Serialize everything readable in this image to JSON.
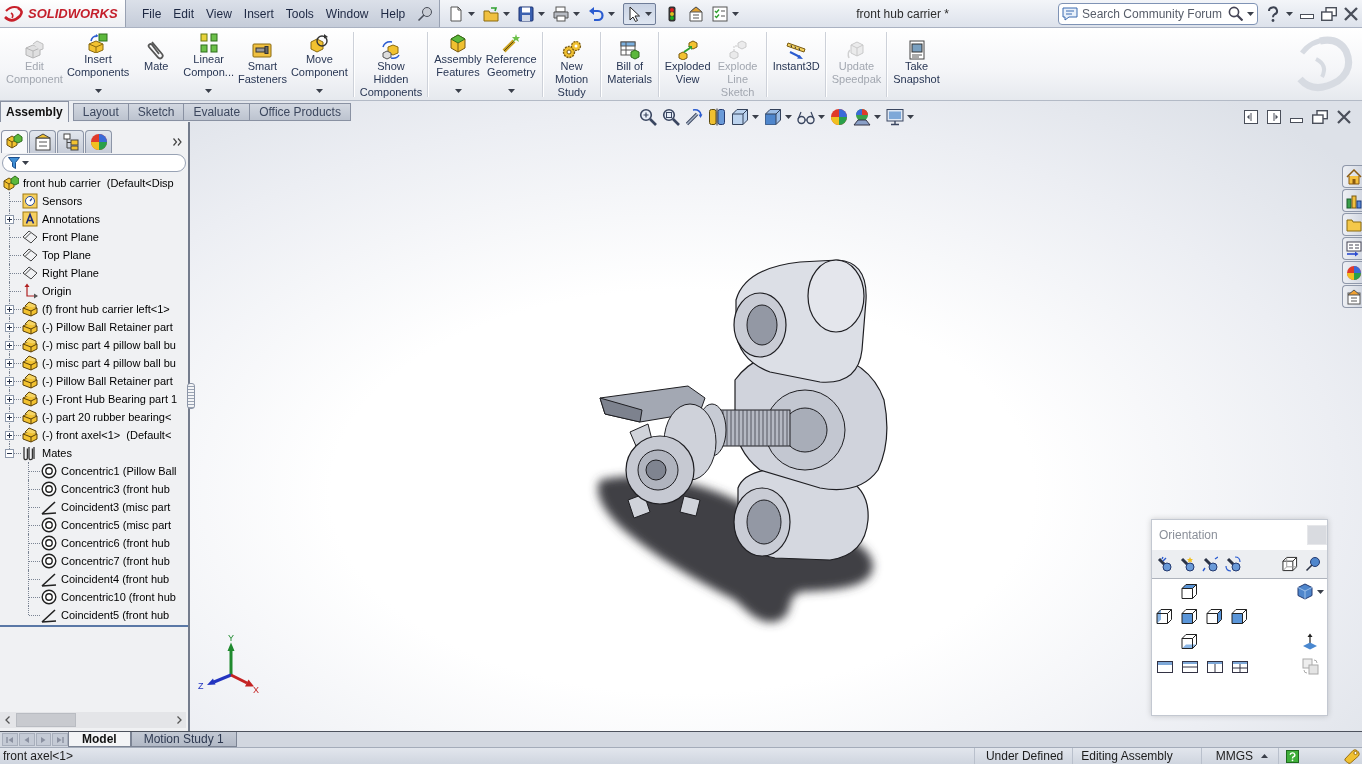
{
  "app": {
    "brand": "SOLIDWORKS",
    "menu": [
      "File",
      "Edit",
      "View",
      "Insert",
      "Tools",
      "Window",
      "Help"
    ],
    "title": "front hub carrier *",
    "search": {
      "placeholder": "Search Community Forum"
    }
  },
  "ribbon": {
    "groups": [
      [
        {
          "label": "Edit\nComponent",
          "disabled": true,
          "has_menu": false
        },
        {
          "label": "Insert\nComponents",
          "disabled": false,
          "has_menu": true
        },
        {
          "label": "Mate",
          "disabled": false,
          "has_menu": false
        },
        {
          "label": "Linear\nCompon...",
          "disabled": false,
          "has_menu": true
        },
        {
          "label": "Smart\nFasteners",
          "disabled": false,
          "has_menu": false
        },
        {
          "label": "Move\nComponent",
          "disabled": false,
          "has_menu": true
        }
      ],
      [
        {
          "label": "Show\nHidden\nComponents",
          "disabled": false,
          "has_menu": false
        }
      ],
      [
        {
          "label": "Assembly\nFeatures",
          "disabled": false,
          "has_menu": true
        },
        {
          "label": "Reference\nGeometry",
          "disabled": false,
          "has_menu": true
        }
      ],
      [
        {
          "label": "New\nMotion\nStudy",
          "disabled": false,
          "has_menu": false
        }
      ],
      [
        {
          "label": "Bill of\nMaterials",
          "disabled": false,
          "has_menu": false
        }
      ],
      [
        {
          "label": "Exploded\nView",
          "disabled": false,
          "has_menu": false
        },
        {
          "label": "Explode\nLine\nSketch",
          "disabled": true,
          "has_menu": false
        }
      ],
      [
        {
          "label": "Instant3D",
          "disabled": false,
          "has_menu": false
        }
      ],
      [
        {
          "label": "Update\nSpeedpak",
          "disabled": true,
          "has_menu": false
        }
      ],
      [
        {
          "label": "Take\nSnapshot",
          "disabled": false,
          "has_menu": false
        }
      ]
    ]
  },
  "command_tabs": [
    {
      "label": "Assembly",
      "selected": true
    },
    {
      "label": "Layout",
      "selected": false
    },
    {
      "label": "Sketch",
      "selected": false
    },
    {
      "label": "Evaluate",
      "selected": false
    },
    {
      "label": "Office Products",
      "selected": false
    }
  ],
  "feature_manager": {
    "tabs": [
      {
        "selected": true
      },
      {
        "selected": false
      },
      {
        "selected": false
      },
      {
        "selected": false
      }
    ],
    "tree": {
      "label": "front hub carrier  (Default<Disp",
      "kind": "assembly",
      "children": [
        {
          "label": "Sensors",
          "kind": "sensors"
        },
        {
          "label": "Annotations",
          "kind": "annotations",
          "expanded": false
        },
        {
          "label": "Front Plane",
          "kind": "plane"
        },
        {
          "label": "Top Plane",
          "kind": "plane"
        },
        {
          "label": "Right Plane",
          "kind": "plane"
        },
        {
          "label": "Origin",
          "kind": "origin"
        },
        {
          "label": "(f) front hub carrier left<1>",
          "kind": "part",
          "expanded": false
        },
        {
          "label": "(-) Pillow Ball Retainer part",
          "kind": "part",
          "expanded": false
        },
        {
          "label": "(-) misc part 4 pillow ball bu",
          "kind": "part",
          "expanded": false
        },
        {
          "label": "(-) misc part 4 pillow ball bu",
          "kind": "part",
          "expanded": false
        },
        {
          "label": "(-) Pillow Ball Retainer part",
          "kind": "part",
          "expanded": false
        },
        {
          "label": "(-) Front Hub Bearing part 1",
          "kind": "part",
          "expanded": false
        },
        {
          "label": "(-) part 20 rubber bearing<",
          "kind": "part",
          "expanded": false
        },
        {
          "label": "(-) front axel<1>  (Default<",
          "kind": "part",
          "expanded": false
        },
        {
          "label": "Mates",
          "kind": "mates",
          "expanded": true,
          "children": [
            {
              "label": "Concentric1 (Pillow Ball",
              "kind": "concentric"
            },
            {
              "label": "Concentric3 (front hub",
              "kind": "concentric"
            },
            {
              "label": "Coincident3 (misc part",
              "kind": "coincident"
            },
            {
              "label": "Concentric5 (misc part",
              "kind": "concentric"
            },
            {
              "label": "Concentric6 (front hub",
              "kind": "concentric"
            },
            {
              "label": "Concentric7 (front hub",
              "kind": "concentric"
            },
            {
              "label": "Coincident4 (front hub",
              "kind": "coincident"
            },
            {
              "label": "Concentric10 (front hub",
              "kind": "concentric"
            },
            {
              "label": "Coincident5 (front hub",
              "kind": "coincident"
            }
          ]
        }
      ]
    }
  },
  "viewport": {
    "triad": [
      {
        "label": "Y",
        "color": "#1f8a2e"
      },
      {
        "label": "Z",
        "color": "#2234c0"
      },
      {
        "label": "X",
        "color": "#c42222"
      }
    ],
    "orientation_panel": {
      "title": "Orientation"
    }
  },
  "model_tabs": [
    {
      "label": "Model",
      "selected": true
    },
    {
      "label": "Motion Study 1",
      "selected": false
    }
  ],
  "status_bar": {
    "selection": "front axel<1>",
    "states": [
      "Under Defined",
      "Editing Assembly"
    ],
    "units": "MMGS"
  }
}
